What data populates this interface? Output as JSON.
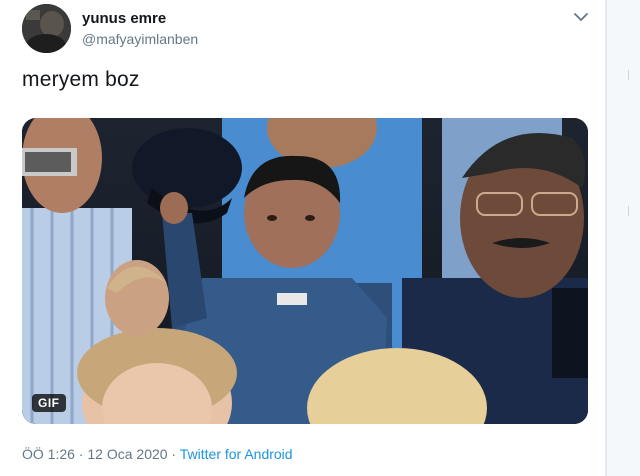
{
  "tweet": {
    "display_name": "yunus emre",
    "handle": "@mafyayimlanben",
    "text": "meryem boz",
    "media_badge": "GIF",
    "time": "ÖÖ 1:26",
    "separator": " · ",
    "date": "12 Oca 2020",
    "source": "Twitter for Android"
  },
  "icons": {
    "menu": "chevron-down-icon",
    "avatar": "avatar-image"
  },
  "colors": {
    "primary_text": "#14171a",
    "secondary_text": "#657786",
    "link": "#1b95e0",
    "background": "#e6ecf0"
  }
}
